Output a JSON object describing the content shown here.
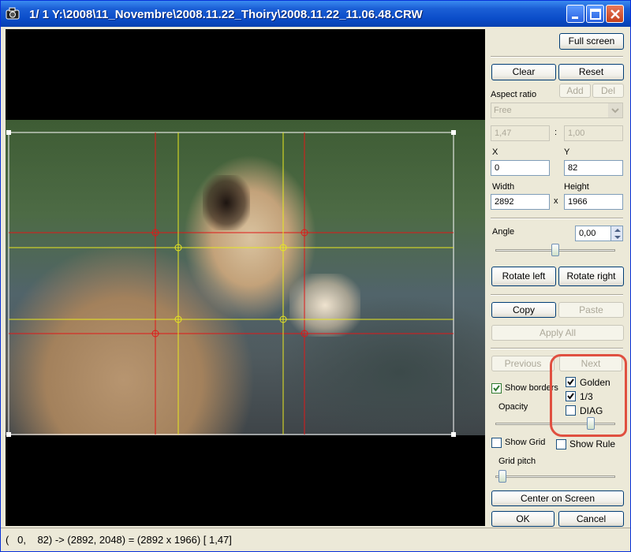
{
  "window": {
    "title": "1/  1  Y:\\2008\\11_Novembre\\2008.11.22_Thoiry\\2008.11.22_11.06.48.CRW",
    "icon": "camera-icon"
  },
  "panel": {
    "full_screen": "Full screen",
    "clear": "Clear",
    "reset": "Reset",
    "add": "Add",
    "del": "Del",
    "aspect_ratio_label": "Aspect ratio",
    "aspect_ratio_value": "Free",
    "ratio_w": "1,47",
    "ratio_sep": ":",
    "ratio_h": "1,00",
    "x_label": "X",
    "x_value": "0",
    "y_label": "Y",
    "y_value": "82",
    "width_label": "Width",
    "width_value": "2892",
    "times": "x",
    "height_label": "Height",
    "height_value": "1966",
    "angle_label": "Angle",
    "angle_value": "0,00",
    "angle_slider_fraction": 0.5,
    "rotate_left": "Rotate left",
    "rotate_right": "Rotate right",
    "copy": "Copy",
    "paste": "Paste",
    "apply_all": "Apply All",
    "previous": "Previous",
    "next": "Next",
    "show_borders": "Show borders",
    "show_borders_checked": true,
    "golden": "Golden",
    "golden_checked": true,
    "third": "1/3",
    "third_checked": true,
    "diag": "DIAG",
    "diag_checked": false,
    "opacity_label": "Opacity",
    "opacity_fraction": 0.82,
    "show_grid": "Show Grid",
    "show_grid_checked": false,
    "show_rule": "Show Rule",
    "show_rule_checked": false,
    "grid_pitch_label": "Grid pitch",
    "grid_pitch_fraction": 0.03,
    "center_on_screen": "Center on Screen",
    "ok": "OK",
    "cancel": "Cancel"
  },
  "overlay_colors": {
    "golden": "#e01818",
    "third": "#e8e820",
    "border": "#ffffff"
  },
  "status": "(   0,    82) -> (2892, 2048) = (2892 x 1966) [ 1,47]"
}
